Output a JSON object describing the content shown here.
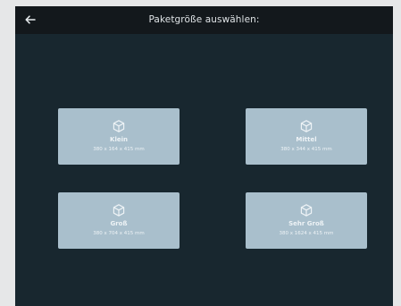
{
  "header": {
    "title": "Paketgröße auswählen:",
    "back_icon": "arrow-left-icon"
  },
  "colors": {
    "background": "#18272f",
    "header": "#13181c",
    "card": "#a9bfcc",
    "card_text": "#eef3f6"
  },
  "package_sizes": [
    {
      "name": "Klein",
      "dimensions": "380 x 164 x 415 mm",
      "icon": "box-icon"
    },
    {
      "name": "Mittel",
      "dimensions": "380 x 344 x 415 mm",
      "icon": "box-icon"
    },
    {
      "name": "Groß",
      "dimensions": "380 x 704 x 415 mm",
      "icon": "box-icon"
    },
    {
      "name": "Sehr Groß",
      "dimensions": "380 x 1624 x 415 mm",
      "icon": "box-icon"
    }
  ]
}
